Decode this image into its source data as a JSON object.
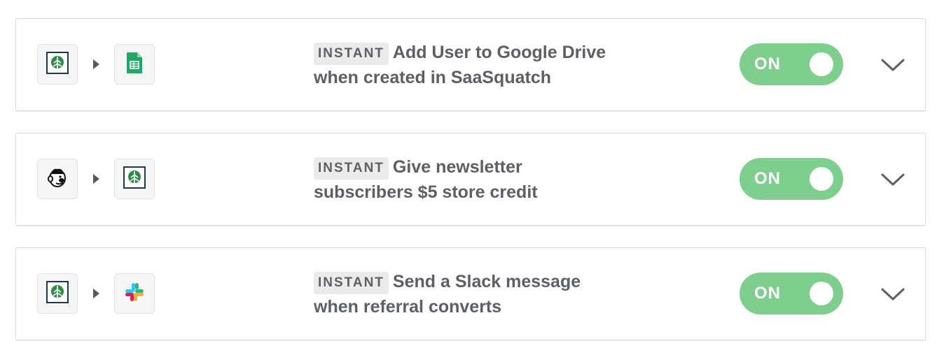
{
  "zaps": [
    {
      "trigger_app": "saasquatch-icon",
      "action_app": "google-sheets-icon",
      "badge": "INSTANT",
      "title": "Add User to Google Drive",
      "title_rest": "when created in SaaSquatch",
      "toggle_label": "ON",
      "enabled": true
    },
    {
      "trigger_app": "mailchimp-icon",
      "action_app": "saasquatch-icon",
      "badge": "INSTANT",
      "title": "Give newsletter",
      "title_rest": "subscribers $5 store credit",
      "toggle_label": "ON",
      "enabled": true
    },
    {
      "trigger_app": "saasquatch-icon",
      "action_app": "slack-icon",
      "badge": "INSTANT",
      "title": "Send a Slack message",
      "title_rest": "when referral converts",
      "toggle_label": "ON",
      "enabled": true
    }
  ],
  "colors": {
    "toggle_on": "#7ecf8e",
    "text": "#5c6066",
    "badge_bg": "#ebebeb",
    "saasquatch_green": "#2f8a4a",
    "sheets_green": "#23a566"
  }
}
